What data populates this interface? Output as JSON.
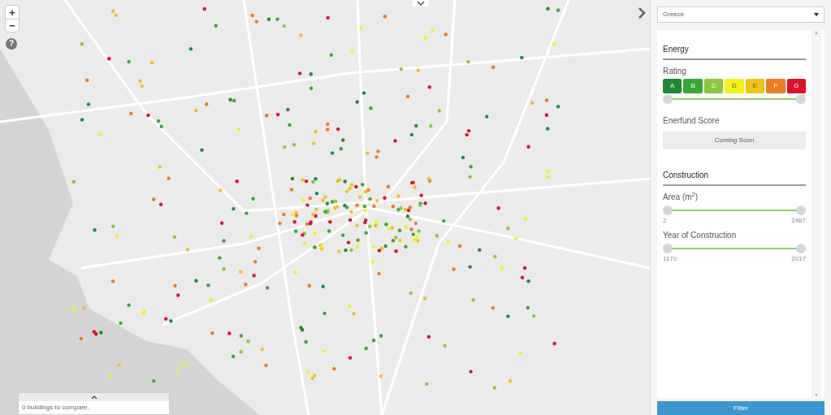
{
  "map": {
    "zoom_in": "+",
    "zoom_out": "−",
    "help": "?"
  },
  "compare": {
    "text": "0 buildings to compare."
  },
  "sidebar": {
    "country": "Greece",
    "energy": {
      "title": "Energy",
      "rating_label": "Rating",
      "ratings": [
        {
          "label": "A",
          "color": "#1e8a33"
        },
        {
          "label": "B",
          "color": "#3aa635"
        },
        {
          "label": "C",
          "color": "#8cc63e"
        },
        {
          "label": "D",
          "color": "#f2f21a"
        },
        {
          "label": "E",
          "color": "#f0c21a"
        },
        {
          "label": "F",
          "color": "#ec7b22"
        },
        {
          "label": "G",
          "color": "#e0102a"
        }
      ],
      "rating_slider": {
        "level": 1
      },
      "score_label": "Enerfund Score",
      "score_button": "Coming Soon"
    },
    "construction": {
      "title": "Construction",
      "sliders": [
        {
          "label": "Area (m$^{2}$)",
          "level": 1,
          "min": "2",
          "max": "2487"
        },
        {
          "label": "Year of Construction",
          "level": 1,
          "min": "1170",
          "max": "2017"
        }
      ]
    },
    "filter_button": "Filter"
  }
}
